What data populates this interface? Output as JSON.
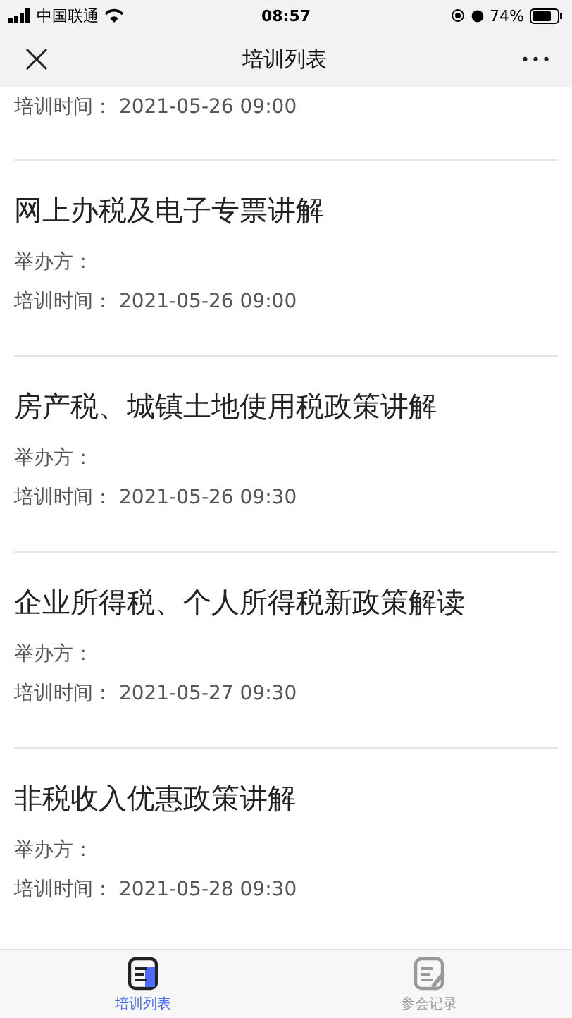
{
  "status_bar": {
    "carrier": "中国联通",
    "time": "08:57",
    "battery": "74%"
  },
  "nav": {
    "title": "培训列表",
    "more": "•••"
  },
  "trainings": [
    {
      "time_label": "培训时间：",
      "time": "2021-05-26 09:00"
    },
    {
      "title": "网上办税及电子专票讲解",
      "organizer_label": "举办方：",
      "time_label": "培训时间：",
      "time": "2021-05-26 09:00"
    },
    {
      "title": "房产税、城镇土地使用税政策讲解",
      "organizer_label": "举办方：",
      "time_label": "培训时间：",
      "time": "2021-05-26 09:30"
    },
    {
      "title": "企业所得税、个人所得税新政策解读",
      "organizer_label": "举办方：",
      "time_label": "培训时间：",
      "time": "2021-05-27 09:30"
    },
    {
      "title": "非税收入优惠政策讲解",
      "organizer_label": "举办方：",
      "time_label": "培训时间：",
      "time": "2021-05-28 09:30"
    }
  ],
  "tabs": [
    {
      "label": "培训列表",
      "selected": true
    },
    {
      "label": "参会记录",
      "selected": false
    }
  ]
}
